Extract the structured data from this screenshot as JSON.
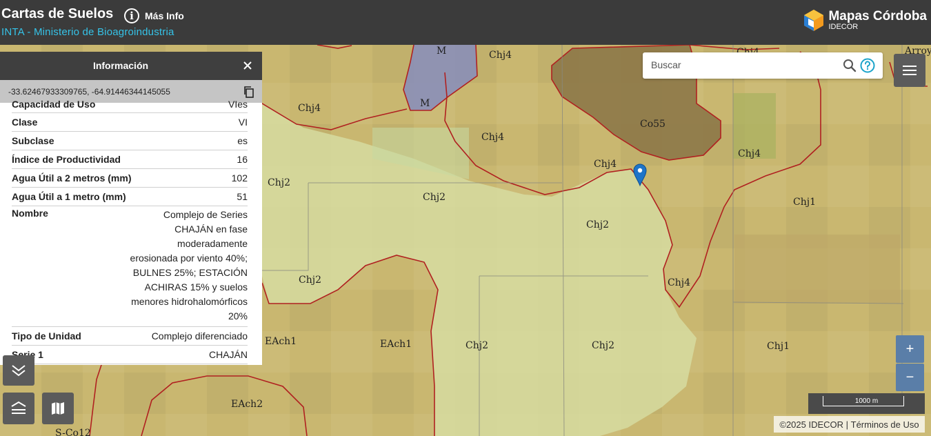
{
  "header": {
    "title": "Cartas de Suelos",
    "subtitle": "INTA - Ministerio de Bioagroindustria",
    "info_label": "Más Info",
    "brand_name": "Mapas Córdoba",
    "brand_sub": "IDECOR"
  },
  "search": {
    "placeholder": "Buscar"
  },
  "panel": {
    "title": "Información",
    "coordinates": "-33.62467933309765, -64.91446344145055",
    "rows": [
      {
        "key": "Capacidad de Uso",
        "value": "VIes"
      },
      {
        "key": "Clase",
        "value": "VI"
      },
      {
        "key": "Subclase",
        "value": "es"
      },
      {
        "key": "Índice de Productividad",
        "value": "16"
      },
      {
        "key": "Agua Útil a 2 metros (mm)",
        "value": "102"
      },
      {
        "key": "Agua Útil a 1 metro (mm)",
        "value": "51"
      },
      {
        "key": "Nombre",
        "value": "Complejo de Series CHAJÁN en fase moderadamente erosionada por viento 40%; BULNES 25%; ESTACIÓN ACHIRAS 15% y suelos menores hidrohalomórficos 20%"
      },
      {
        "key": "Tipo de Unidad",
        "value": "Complejo diferenciado"
      },
      {
        "key": "Serie 1",
        "value": "CHAJÁN"
      }
    ]
  },
  "map": {
    "labels": [
      "M",
      "M",
      "Chj4",
      "Chj4",
      "Chj4",
      "Co55",
      "Chj4",
      "Chj4",
      "Chj4",
      "Chj2",
      "Chj2",
      "Chj2",
      "Chj1",
      "Chj2",
      "Chj4",
      "Chj2",
      "EAch1",
      "EAch1",
      "Chj2",
      "Chj2",
      "Chj1",
      "EAch2",
      "S-Co12",
      "Chj4",
      "Arroy"
    ],
    "scale_label": "1000 m",
    "zoom_in": "+",
    "zoom_out": "−"
  },
  "footer": {
    "copyright": "©2025 IDECOR",
    "separator": " | ",
    "terms": "Términos de Uso"
  },
  "colors": {
    "topbar": "#3b3b3b",
    "accent": "#35c3e8",
    "soil_outline": "#b02020",
    "zoom_button": "#5a7ea8",
    "marker": "#1e74c8"
  }
}
